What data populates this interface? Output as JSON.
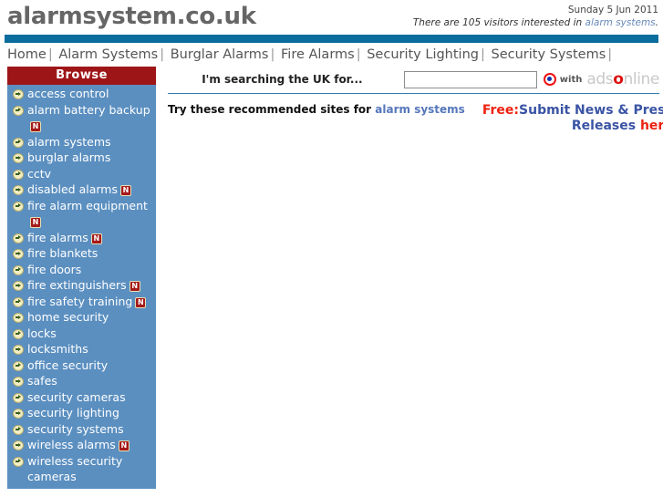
{
  "header": {
    "logo": "alarmsystem.co.uk",
    "date": "Sunday 5 Jun 2011",
    "visitors_prefix": "There are 105 visitors interested in ",
    "visitors_link": "alarm systems",
    "visitors_suffix": ".",
    "visitor_count": 105
  },
  "nav": {
    "items": [
      "Home",
      "Alarm Systems",
      "Burglar Alarms",
      "Fire Alarms",
      "Security Lighting",
      "Security Systems"
    ],
    "separator": "|"
  },
  "sidebar": {
    "title": "Browse",
    "badge_new": "N",
    "items": [
      {
        "label": "access control",
        "new": false
      },
      {
        "label": "alarm battery backup",
        "new": true
      },
      {
        "label": "alarm systems",
        "new": false
      },
      {
        "label": "burglar alarms",
        "new": false
      },
      {
        "label": "cctv",
        "new": false
      },
      {
        "label": "disabled alarms",
        "new": true
      },
      {
        "label": "fire alarm equipment",
        "new": true
      },
      {
        "label": "fire alarms",
        "new": true
      },
      {
        "label": "fire blankets",
        "new": false
      },
      {
        "label": "fire doors",
        "new": false
      },
      {
        "label": "fire extinguishers",
        "new": true
      },
      {
        "label": "fire safety training",
        "new": true
      },
      {
        "label": "home security",
        "new": false
      },
      {
        "label": "locks",
        "new": false
      },
      {
        "label": "locksmiths",
        "new": false
      },
      {
        "label": "office security",
        "new": false
      },
      {
        "label": "safes",
        "new": false
      },
      {
        "label": "security cameras",
        "new": false
      },
      {
        "label": "security lighting",
        "new": false
      },
      {
        "label": "security systems",
        "new": false
      },
      {
        "label": "wireless alarms",
        "new": true
      },
      {
        "label": "wireless security cameras",
        "new": false
      }
    ]
  },
  "search": {
    "label": "I'm searching the UK for...",
    "value": "",
    "placeholder": "",
    "with_text": "with",
    "brand_before": "ads",
    "brand_o": "o",
    "brand_after": "nline"
  },
  "main": {
    "recommended_prefix": "Try these recommended sites for ",
    "recommended_link": "alarm systems"
  },
  "press": {
    "free_label": "Free:",
    "submit_line1": "Submit News & Press",
    "submit_line2": "Releases ",
    "here_label": "here"
  },
  "colors": {
    "teal_bar": "#0b6d9e",
    "sidebar_header": "#9e1518",
    "sidebar_body": "#5b8fc0",
    "link_blue": "#3a54a5",
    "accent_red": "#ee2211",
    "logo_gray": "#666666"
  }
}
